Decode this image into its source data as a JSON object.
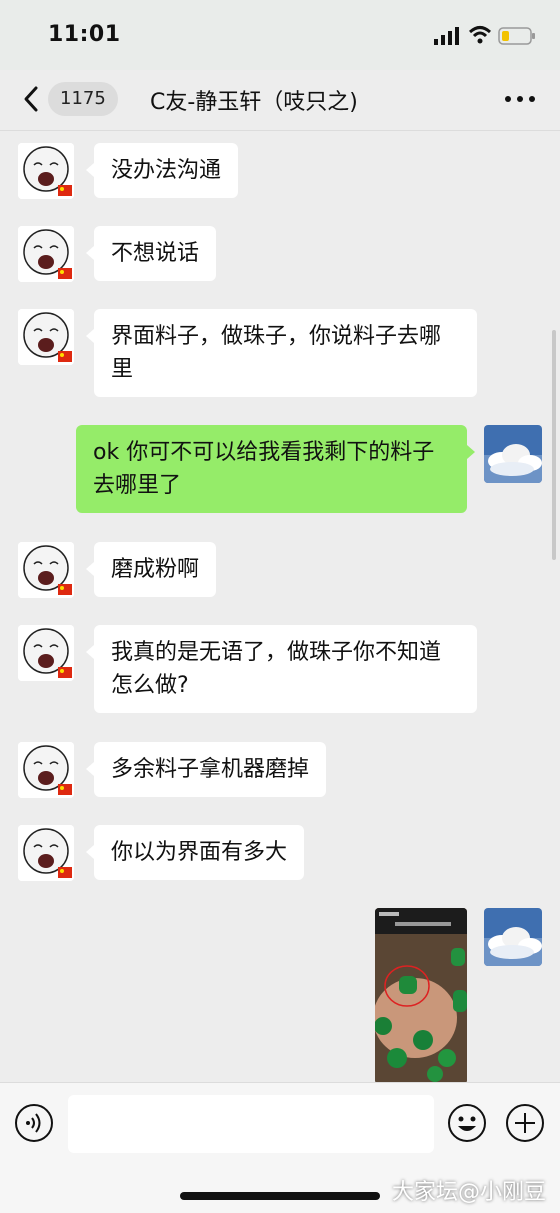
{
  "status_bar": {
    "time": "11:01"
  },
  "header": {
    "back_label": "<",
    "unread_count": "1175",
    "title": "C友-静玉轩（吱只之)"
  },
  "messages": [
    {
      "side": "left",
      "text": "没办法沟通"
    },
    {
      "side": "left",
      "text": "不想说话"
    },
    {
      "side": "left",
      "text": "界面料子，做珠子，你说料子去哪里"
    },
    {
      "side": "right",
      "text": "ok 你可不可以给我看我剩下的料子去哪里了"
    },
    {
      "side": "left",
      "text": "磨成粉啊"
    },
    {
      "side": "left",
      "text": "我真的是无语了，做珠子你不知道怎么做?"
    },
    {
      "side": "left",
      "text": "多余料子拿机器磨掉"
    },
    {
      "side": "left",
      "text": "你以为界面有多大"
    },
    {
      "side": "right",
      "type": "image"
    }
  ],
  "input_bar": {
    "value": ""
  },
  "watermark": "大家坛@小刚豆",
  "colors": {
    "bubble_self": "#95ec69",
    "bubble_other": "#ffffff",
    "background": "#ededed"
  }
}
